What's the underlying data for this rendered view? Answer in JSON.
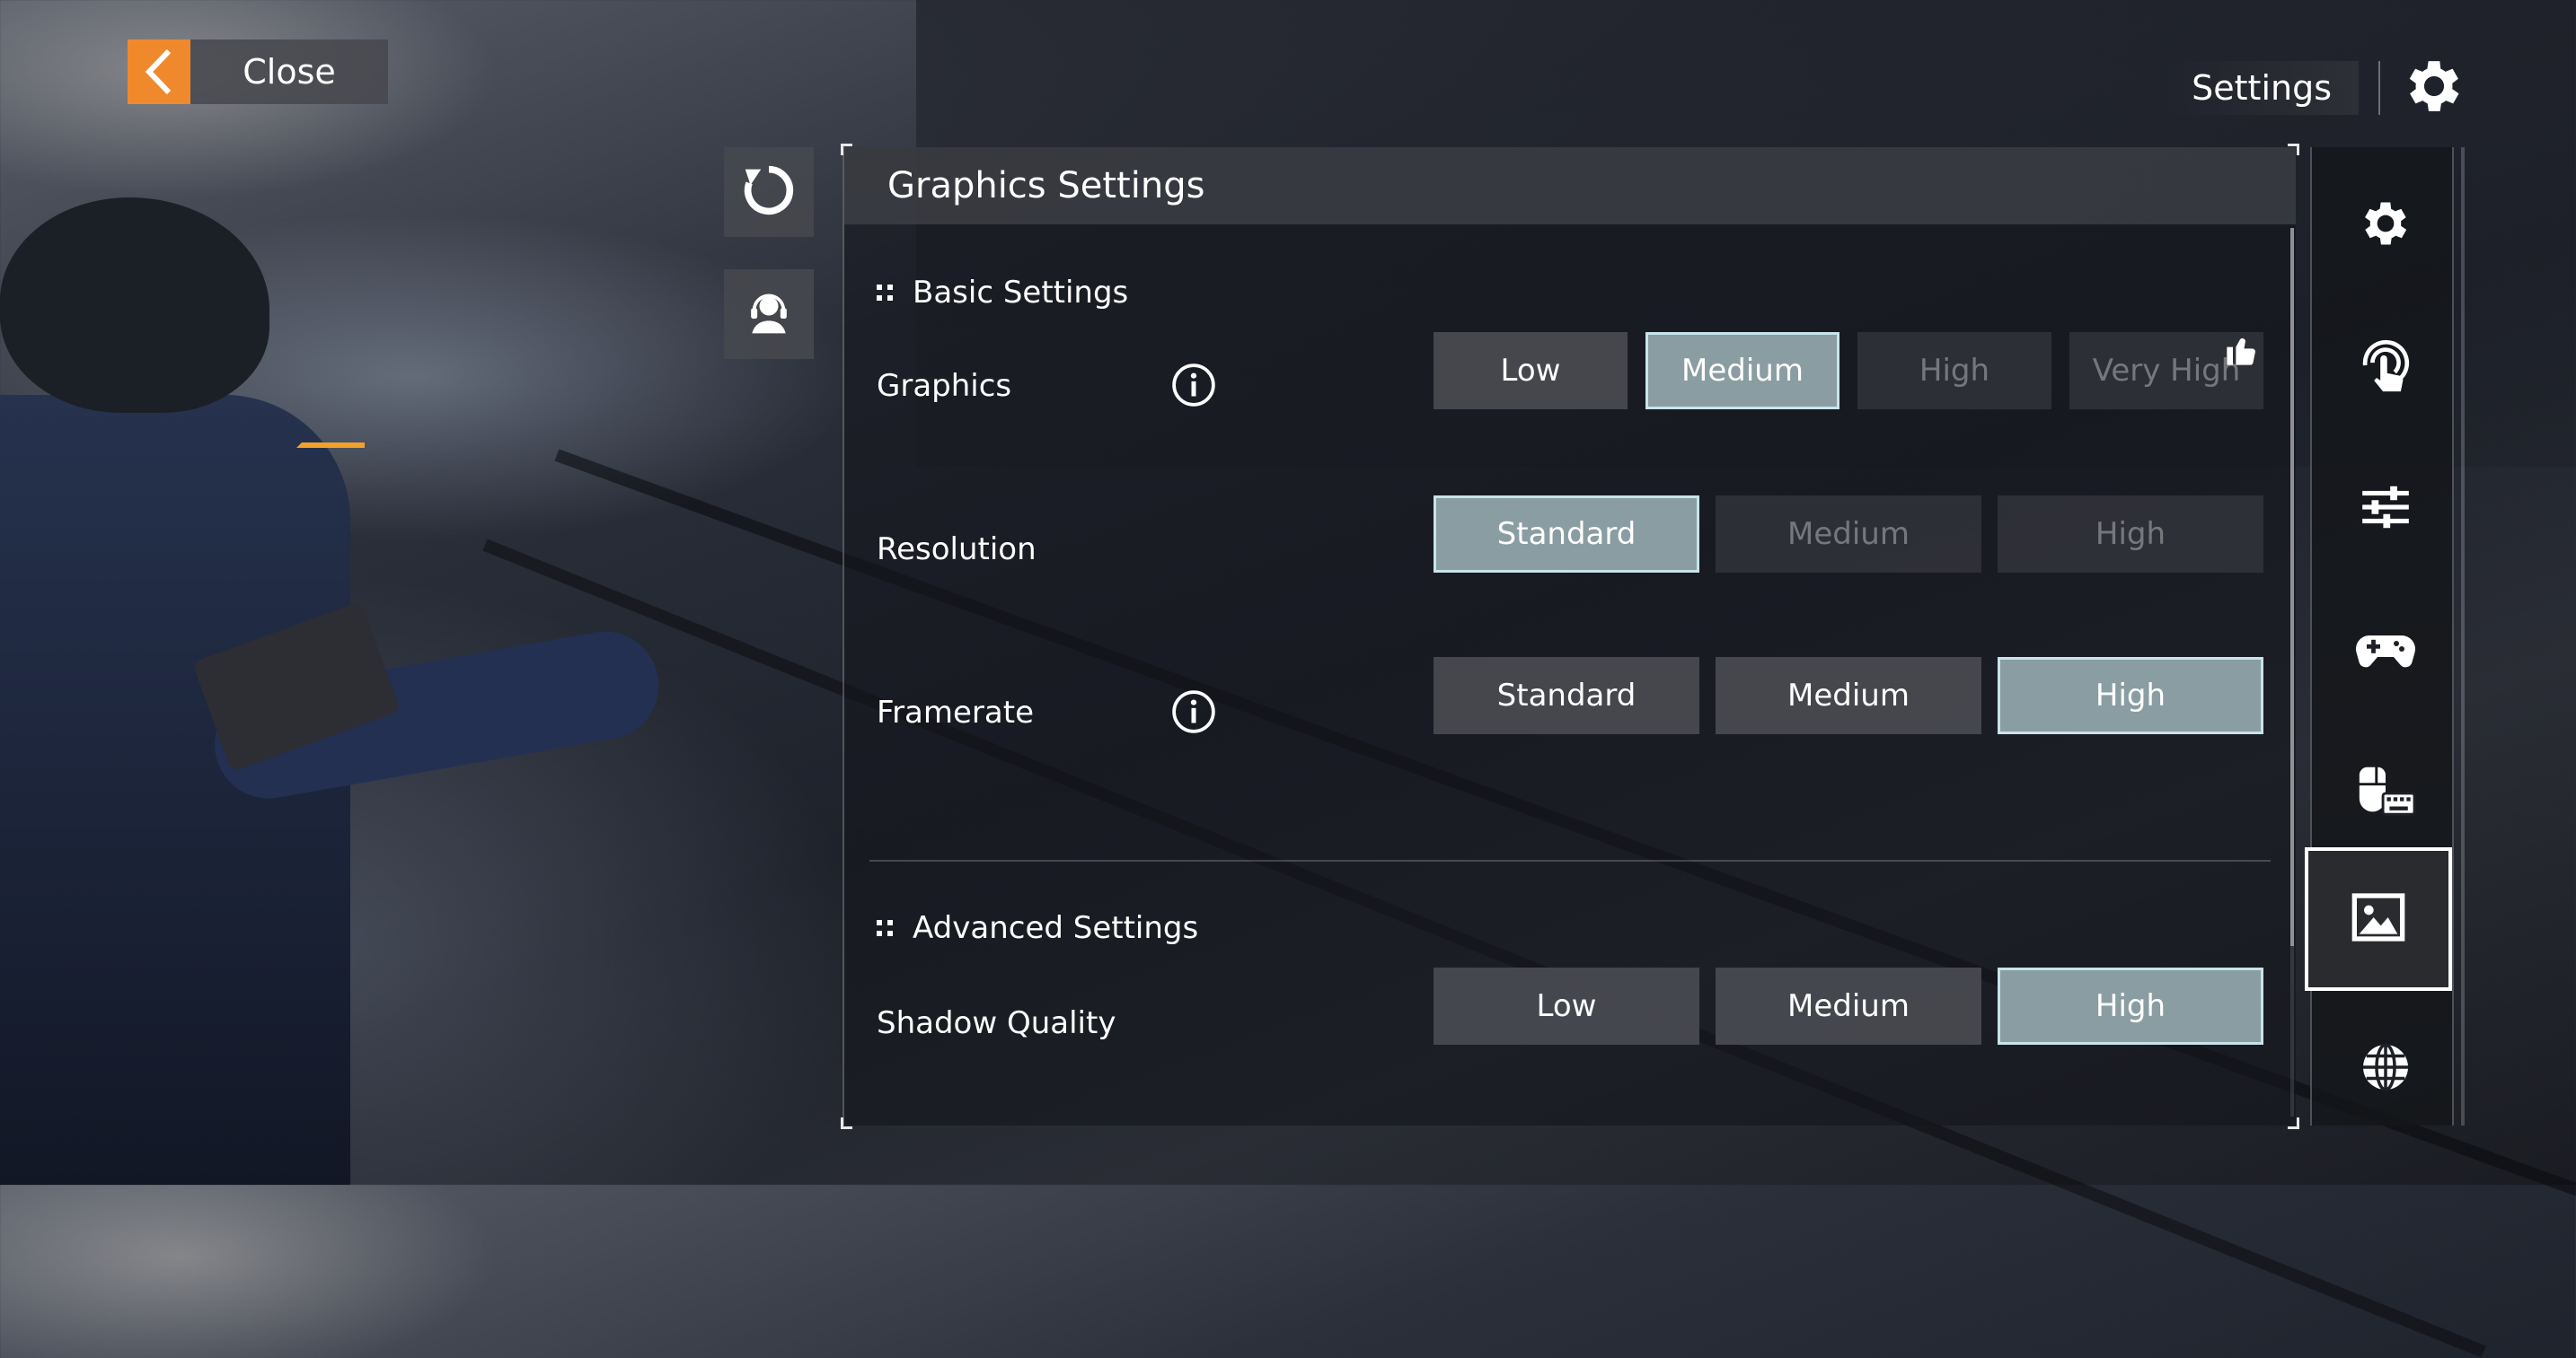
{
  "close_button": {
    "label": "Close"
  },
  "top_bar": {
    "title": "Settings"
  },
  "panel": {
    "title": "Graphics Settings",
    "sections": {
      "basic": {
        "title": "Basic Settings"
      },
      "advanced": {
        "title": "Advanced Settings"
      }
    },
    "rows": {
      "graphics": {
        "label": "Graphics",
        "options": [
          "Low",
          "Medium",
          "High",
          "Very High"
        ],
        "selected": "Medium",
        "recommended": "Very High"
      },
      "resolution": {
        "label": "Resolution",
        "options": [
          "Standard",
          "Medium",
          "High"
        ],
        "selected": "Standard"
      },
      "framerate": {
        "label": "Framerate",
        "options": [
          "Standard",
          "Medium",
          "High"
        ],
        "selected": "High"
      },
      "shadow_quality": {
        "label": "Shadow Quality",
        "options": [
          "Low",
          "Medium",
          "High"
        ],
        "selected": "High"
      }
    }
  },
  "nav": {
    "items": [
      "general-icon",
      "touch-icon",
      "sliders-icon",
      "gamepad-icon",
      "mouse-keyboard-icon",
      "graphics-icon",
      "language-icon"
    ],
    "active": "graphics-icon"
  },
  "colors": {
    "accent": "#f0892c",
    "selected": "#8a9da2",
    "selected_border": "#c8e4ea"
  }
}
